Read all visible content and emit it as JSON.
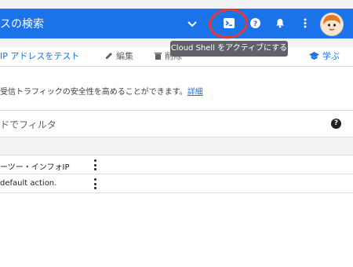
{
  "topbar": {
    "search_text": "スの検索",
    "tooltip": "Cloud Shell をアクティブにする",
    "icons": [
      "chevron-down-icon",
      "cloud-shell-icon",
      "help-icon",
      "bell-icon",
      "more-vert-icon",
      "avatar"
    ]
  },
  "actions": {
    "test_ip": "IP アドレスをテスト",
    "edit": "編集",
    "delete": "削除",
    "learn": "学ぶ"
  },
  "info": {
    "text": "受信トラフィックの安全性を高めることができます。",
    "link": "詳細"
  },
  "filter": {
    "placeholder": "ドでフィルタ"
  },
  "table": {
    "rows": [
      {
        "text": "ーツー・インフォIP"
      },
      {
        "text": "default action."
      }
    ]
  },
  "colors": {
    "brand_blue": "#1a73e8",
    "highlight_red": "#e53935"
  }
}
